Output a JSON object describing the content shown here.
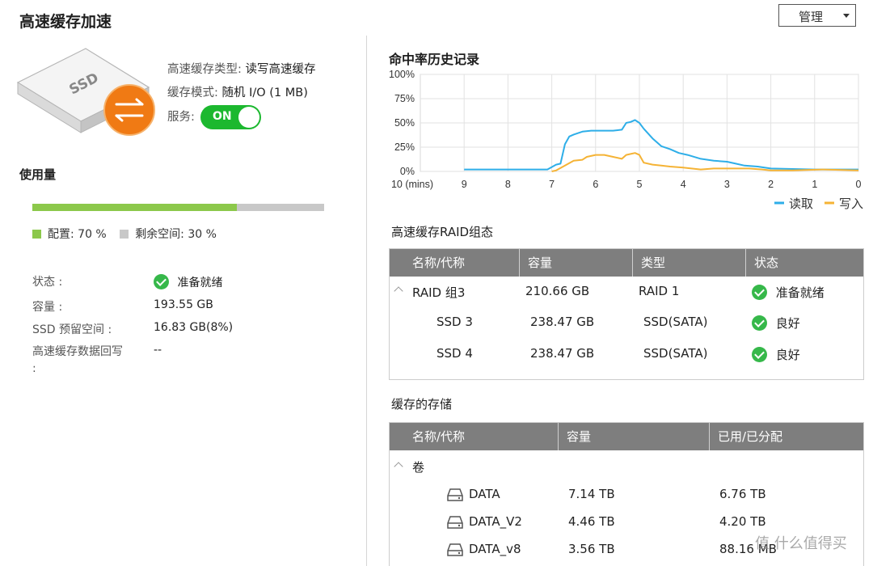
{
  "header": {
    "title": "高速缓存加速",
    "manage_label": "管理"
  },
  "cache_info": {
    "type_label": "高速缓存类型:",
    "type_value": "读写高速缓存",
    "mode_label": "缓存模式:",
    "mode_value": "随机 I/O (1 MB)",
    "service_label": "服务:",
    "service_toggle": "ON",
    "ssd_label": "SSD"
  },
  "usage": {
    "heading": "使用量",
    "allocated_label": "配置: 70 %",
    "free_label": "剩余空间: 30 %",
    "allocated_fraction": 0.7,
    "colors": {
      "allocated": "#8cc84b",
      "free": "#c8c8c8"
    }
  },
  "status": {
    "rows": [
      {
        "label": "状态 :",
        "value": "准备就绪",
        "check": true
      },
      {
        "label": "容量 :",
        "value": "193.55 GB",
        "check": false
      },
      {
        "label": "SSD 预留空间 :",
        "value": "16.83 GB(8%)",
        "check": false
      },
      {
        "label": "高速缓存数据回写 :",
        "value": "--",
        "check": false
      }
    ]
  },
  "chart_data": {
    "type": "line",
    "title": "命中率历史记录",
    "xlabel": "10 (mins)",
    "x_ticks": [
      "10 (mins)",
      "9",
      "8",
      "7",
      "6",
      "5",
      "4",
      "3",
      "2",
      "1",
      "0"
    ],
    "y_ticks": [
      "100%",
      "75%",
      "50%",
      "25%",
      "0%"
    ],
    "xlim": [
      10,
      0
    ],
    "ylim": [
      0,
      100
    ],
    "grid": true,
    "legend_position": "bottom-right",
    "series": [
      {
        "name": "读取",
        "color": "#2eaee8",
        "points": [
          [
            9,
            2
          ],
          [
            7.1,
            2
          ],
          [
            6.9,
            7
          ],
          [
            6.8,
            8
          ],
          [
            6.7,
            28
          ],
          [
            6.6,
            36
          ],
          [
            6.5,
            38
          ],
          [
            6.3,
            41
          ],
          [
            6.1,
            42
          ],
          [
            5.8,
            42
          ],
          [
            5.6,
            42
          ],
          [
            5.4,
            43
          ],
          [
            5.3,
            50
          ],
          [
            5.2,
            51
          ],
          [
            5.1,
            53
          ],
          [
            5.0,
            50
          ],
          [
            4.9,
            44
          ],
          [
            4.7,
            34
          ],
          [
            4.5,
            26
          ],
          [
            4.3,
            23
          ],
          [
            4.1,
            19
          ],
          [
            3.9,
            17
          ],
          [
            3.6,
            13
          ],
          [
            3.3,
            11
          ],
          [
            3.0,
            10
          ],
          [
            2.8,
            8
          ],
          [
            2.6,
            6
          ],
          [
            2.3,
            5
          ],
          [
            2.0,
            3
          ],
          [
            1.0,
            2
          ],
          [
            0,
            2
          ]
        ]
      },
      {
        "name": "写入",
        "color": "#f5b335",
        "points": [
          [
            7.0,
            0
          ],
          [
            6.9,
            1
          ],
          [
            6.7,
            6
          ],
          [
            6.5,
            11
          ],
          [
            6.3,
            12
          ],
          [
            6.2,
            15
          ],
          [
            6.0,
            17
          ],
          [
            5.8,
            17
          ],
          [
            5.6,
            15
          ],
          [
            5.4,
            13
          ],
          [
            5.3,
            17
          ],
          [
            5.2,
            18
          ],
          [
            5.1,
            19
          ],
          [
            5.0,
            17
          ],
          [
            4.9,
            9
          ],
          [
            4.7,
            7
          ],
          [
            4.5,
            6
          ],
          [
            4.3,
            5
          ],
          [
            4.0,
            4
          ],
          [
            3.6,
            2
          ],
          [
            3.3,
            3
          ],
          [
            2.8,
            3
          ],
          [
            2.5,
            3
          ],
          [
            2.2,
            2
          ],
          [
            2.0,
            1
          ],
          [
            1.5,
            1
          ],
          [
            0.8,
            2
          ],
          [
            0,
            1
          ]
        ]
      }
    ]
  },
  "raid_table": {
    "heading": "高速缓存RAID组态",
    "columns": [
      "名称/代称",
      "容量",
      "类型",
      "状态"
    ],
    "group": {
      "name": "RAID 组3",
      "capacity": "210.66 GB",
      "type": "RAID 1",
      "status": "准备就绪"
    },
    "rows": [
      {
        "name": "SSD 3",
        "capacity": "238.47 GB",
        "type": "SSD(SATA)",
        "status": "良好"
      },
      {
        "name": "SSD 4",
        "capacity": "238.47 GB",
        "type": "SSD(SATA)",
        "status": "良好"
      }
    ]
  },
  "storage_table": {
    "heading": "缓存的存储",
    "columns": [
      "名称/代称",
      "容量",
      "已用/已分配"
    ],
    "group": "卷",
    "rows": [
      {
        "name": "DATA",
        "capacity": "7.14 TB",
        "used": "6.76 TB"
      },
      {
        "name": "DATA_V2",
        "capacity": "4.46 TB",
        "used": "4.20 TB"
      },
      {
        "name": "DATA_v8",
        "capacity": "3.56 TB",
        "used": "88.16 MB"
      }
    ]
  },
  "watermark": "值 什么值得买",
  "colors": {
    "accent_green": "#1cb82f",
    "table_header": "#7e7e7e",
    "orange_badge": "#f07a14"
  }
}
